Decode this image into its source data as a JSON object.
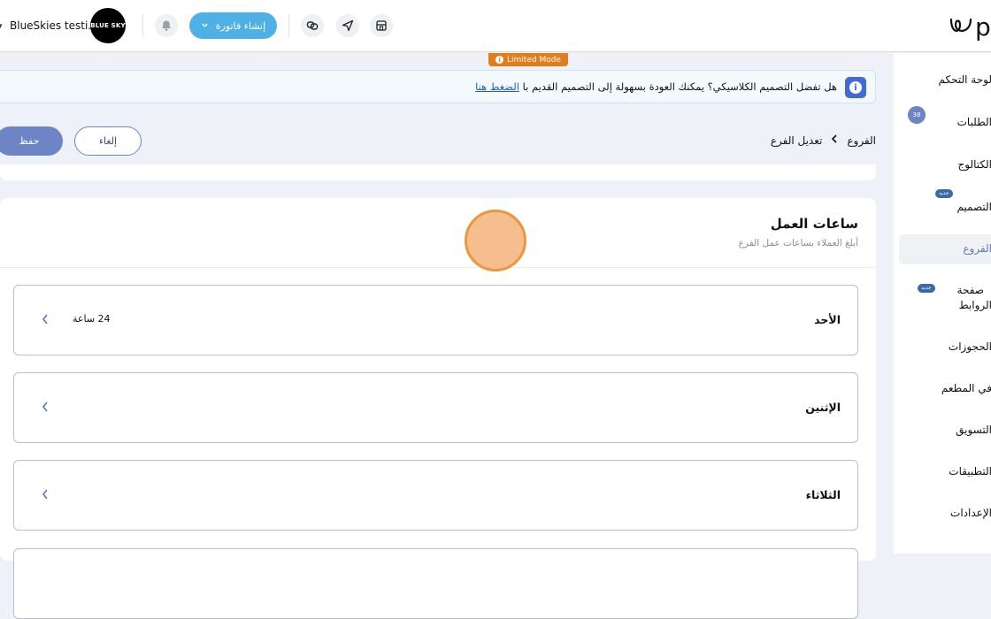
{
  "topbar": {
    "brand": "pa",
    "user_name": "BlueSkies testi...",
    "avatar_text": "BLUE SKY",
    "create_invoice_label": "إنشاء فاتورة"
  },
  "limited_mode": "Limited Mode",
  "banner": {
    "message": "هل تفضل التصميم الكلاسيكي؟ يمكنك العودة بسهولة إلى التصميم القديم با",
    "link": "الضغط هنا"
  },
  "breadcrumb": {
    "parent": "الفروع",
    "current": "تعديل الفرع"
  },
  "actions": {
    "cancel": "إلغاء",
    "save": "حفظ"
  },
  "sidebar": {
    "items": [
      {
        "label": "لوحة التحكم"
      },
      {
        "label": "الطلبات",
        "count": "38"
      },
      {
        "label": "الكتالوج"
      },
      {
        "label": "التصميم",
        "badge": "جديد"
      },
      {
        "label": "الفروع"
      },
      {
        "label": "صفحة",
        "label2": "الروابط",
        "badge": "جديد"
      },
      {
        "label": "الحجوزات"
      },
      {
        "label": "في المطعم"
      },
      {
        "label": "التسويق"
      },
      {
        "label": "التطبيقات"
      },
      {
        "label": "الإعدادات"
      }
    ]
  },
  "working_hours": {
    "title": "ساعات العمل",
    "subtitle": "أبلغ العملاء بساعات عمل الفرع",
    "days": [
      {
        "name": "الأحد",
        "hours": "24 ساعة"
      },
      {
        "name": "الإثنين",
        "hours": ""
      },
      {
        "name": "الثلاثاء",
        "hours": ""
      }
    ]
  },
  "colors": {
    "accent": "#6d85c4",
    "invoice_button": "#4fb0e6",
    "limited_mode": "#e27d1c",
    "info_icon": "#3f6ad8"
  }
}
